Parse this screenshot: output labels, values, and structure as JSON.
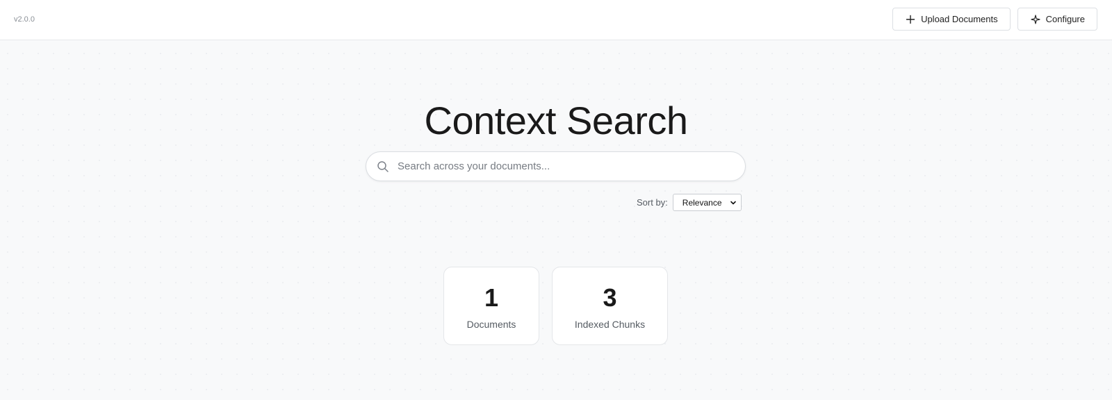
{
  "header": {
    "version": "v2.0.0",
    "upload_label": "Upload Documents",
    "configure_label": "Configure",
    "upload_icon": "plus-icon",
    "configure_icon": "sparkle-icon"
  },
  "main": {
    "title": "Context Search",
    "search": {
      "placeholder": "Search across your documents...",
      "value": "",
      "icon": "search-icon"
    },
    "sort": {
      "label": "Sort by:",
      "selected": "Relevance"
    },
    "stats": [
      {
        "value": "1",
        "label": "Documents"
      },
      {
        "value": "3",
        "label": "Indexed Chunks"
      }
    ]
  },
  "colors": {
    "background": "#f8f9fa",
    "surface": "#ffffff",
    "border": "#dcdfe3",
    "text_primary": "#1a1a1a",
    "text_secondary": "#555b62"
  }
}
